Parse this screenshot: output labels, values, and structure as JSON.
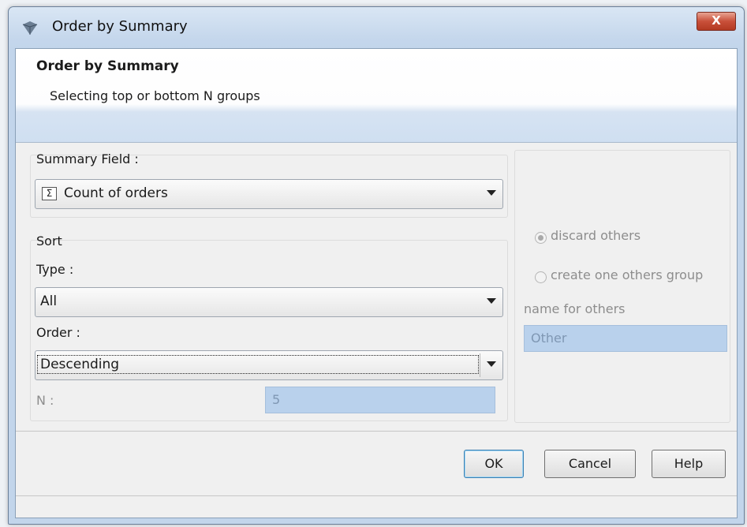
{
  "window": {
    "title": "Order by Summary",
    "close_glyph": "X"
  },
  "header": {
    "title": "Order by Summary",
    "subtitle": "Selecting top or bottom N groups"
  },
  "summary": {
    "label": "Summary Field :",
    "value": "Count of orders",
    "icon": "sigma-icon"
  },
  "sort": {
    "label": "Sort",
    "type_label": "Type :",
    "type_value": "All",
    "order_label": "Order :",
    "order_value": "Descending",
    "n_label": "N :",
    "n_value": "5"
  },
  "others": {
    "discard_label": "discard others",
    "discard_selected": true,
    "create_label": "create one others group",
    "create_selected": false,
    "name_label": "name for others",
    "name_value": "Other"
  },
  "buttons": {
    "ok": "OK",
    "cancel": "Cancel",
    "help": "Help"
  }
}
